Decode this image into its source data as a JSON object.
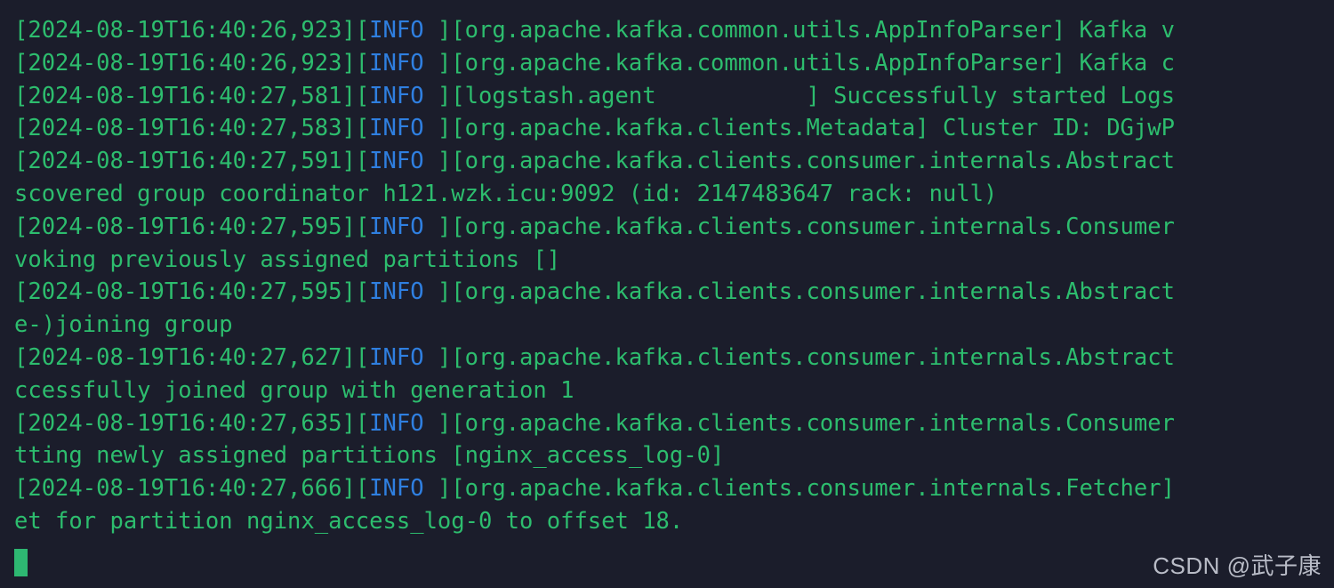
{
  "terminal": {
    "background_color": "#1b1d2b",
    "text_color": "#2dbd6e",
    "level_color": "#2f7fe0",
    "cursor_color": "#2eb872",
    "lines": [
      {
        "timestamp": "[2024-08-19T16:40:26,923]",
        "level": "INFO ",
        "message": "[org.apache.kafka.common.utils.AppInfoParser] Kafka v"
      },
      {
        "timestamp": "[2024-08-19T16:40:26,923]",
        "level": "INFO ",
        "message": "[org.apache.kafka.common.utils.AppInfoParser] Kafka c"
      },
      {
        "timestamp": "[2024-08-19T16:40:27,581]",
        "level": "INFO ",
        "message": "[logstash.agent           ] Successfully started Logs"
      },
      {
        "timestamp": "[2024-08-19T16:40:27,583]",
        "level": "INFO ",
        "message": "[org.apache.kafka.clients.Metadata] Cluster ID: DGjwP"
      },
      {
        "timestamp": "[2024-08-19T16:40:27,591]",
        "level": "INFO ",
        "message": "[org.apache.kafka.clients.consumer.internals.Abstract"
      },
      {
        "timestamp": "",
        "level": "",
        "message": "scovered group coordinator h121.wzk.icu:9092 (id: 2147483647 rack: null)"
      },
      {
        "timestamp": "[2024-08-19T16:40:27,595]",
        "level": "INFO ",
        "message": "[org.apache.kafka.clients.consumer.internals.Consumer"
      },
      {
        "timestamp": "",
        "level": "",
        "message": "voking previously assigned partitions []"
      },
      {
        "timestamp": "[2024-08-19T16:40:27,595]",
        "level": "INFO ",
        "message": "[org.apache.kafka.clients.consumer.internals.Abstract"
      },
      {
        "timestamp": "",
        "level": "",
        "message": "e-)joining group"
      },
      {
        "timestamp": "[2024-08-19T16:40:27,627]",
        "level": "INFO ",
        "message": "[org.apache.kafka.clients.consumer.internals.Abstract"
      },
      {
        "timestamp": "",
        "level": "",
        "message": "ccessfully joined group with generation 1"
      },
      {
        "timestamp": "[2024-08-19T16:40:27,635]",
        "level": "INFO ",
        "message": "[org.apache.kafka.clients.consumer.internals.Consumer"
      },
      {
        "timestamp": "",
        "level": "",
        "message": "tting newly assigned partitions [nginx_access_log-0]"
      },
      {
        "timestamp": "[2024-08-19T16:40:27,666]",
        "level": "INFO ",
        "message": "[org.apache.kafka.clients.consumer.internals.Fetcher]"
      },
      {
        "timestamp": "",
        "level": "",
        "message": "et for partition nginx_access_log-0 to offset 18."
      }
    ],
    "cursor": {
      "visible": true,
      "glyph": "block"
    }
  },
  "watermark": {
    "text": "CSDN @武子康"
  }
}
